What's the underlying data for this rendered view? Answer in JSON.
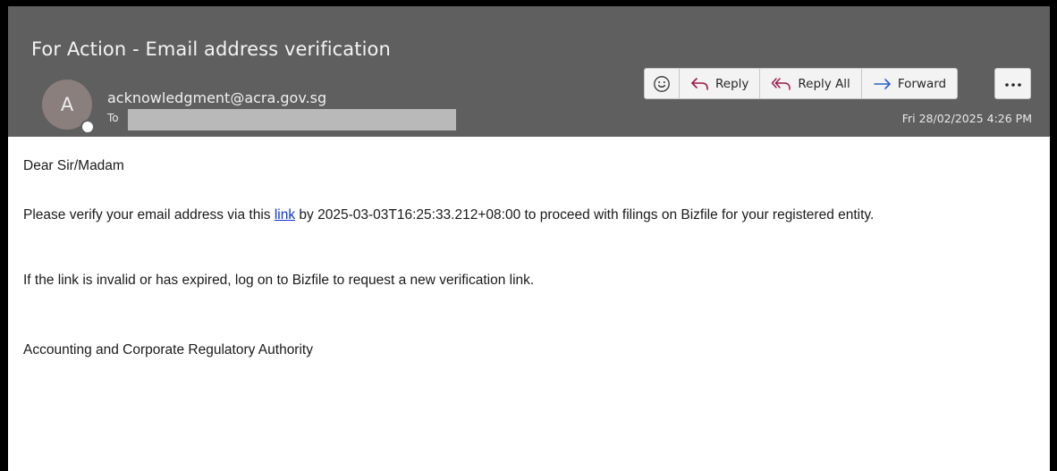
{
  "email": {
    "subject": "For Action - Email address verification",
    "avatar_initial": "A",
    "sender": "acknowledgment@acra.gov.sg",
    "to_label": "To",
    "date": "Fri 28/02/2025 4:26 PM"
  },
  "actions": {
    "reply": "Reply",
    "reply_all": "Reply All",
    "forward": "Forward"
  },
  "body": {
    "greeting": "Dear Sir/Madam",
    "para1_before": "Please verify your email address via this ",
    "link_text": "link",
    "para1_after": " by 2025-03-03T16:25:33.212+08:00 to proceed with filings on Bizfile for your registered entity.",
    "para2": "If the link is invalid or has expired, log on to Bizfile to request a new verification link.",
    "signature": "Accounting and Corporate Regulatory Authority"
  },
  "colors": {
    "header_bg": "#5f5f5f",
    "link": "#0b36d8",
    "reply_all_icon": "#9b1b4f",
    "forward_icon": "#2a62c9"
  }
}
